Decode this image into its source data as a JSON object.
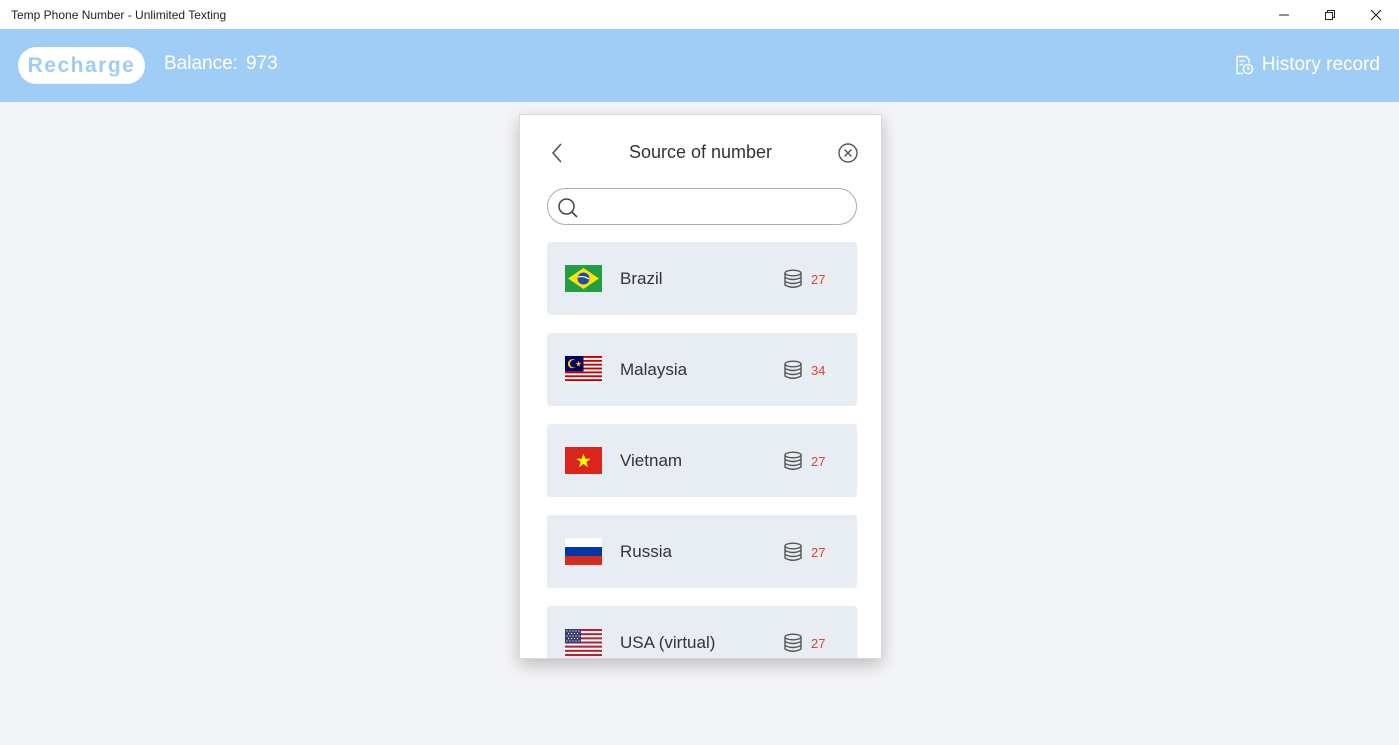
{
  "window": {
    "title": "Temp Phone Number - Unlimited Texting",
    "controls": [
      "minimize-icon",
      "restore-icon",
      "close-icon"
    ]
  },
  "header": {
    "recharge_label": "Recharge",
    "balance_label": "Balance:",
    "balance_value": "973",
    "history_label": "History record"
  },
  "modal": {
    "title": "Source of number",
    "search_placeholder": "",
    "search_value": "",
    "countries": [
      {
        "name": "Brazil",
        "price": "27",
        "flag": "brazil-flag"
      },
      {
        "name": "Malaysia",
        "price": "34",
        "flag": "malaysia-flag"
      },
      {
        "name": "Vietnam",
        "price": "27",
        "flag": "vietnam-flag"
      },
      {
        "name": "Russia",
        "price": "27",
        "flag": "russia-flag"
      },
      {
        "name": "USA (virtual)",
        "price": "27",
        "flag": "usa-flag"
      }
    ]
  },
  "colors": {
    "header_bg": "#a0cdf6",
    "page_bg": "#f3f4f6",
    "item_bg": "#e8ecf3",
    "price": "#e0452d"
  }
}
